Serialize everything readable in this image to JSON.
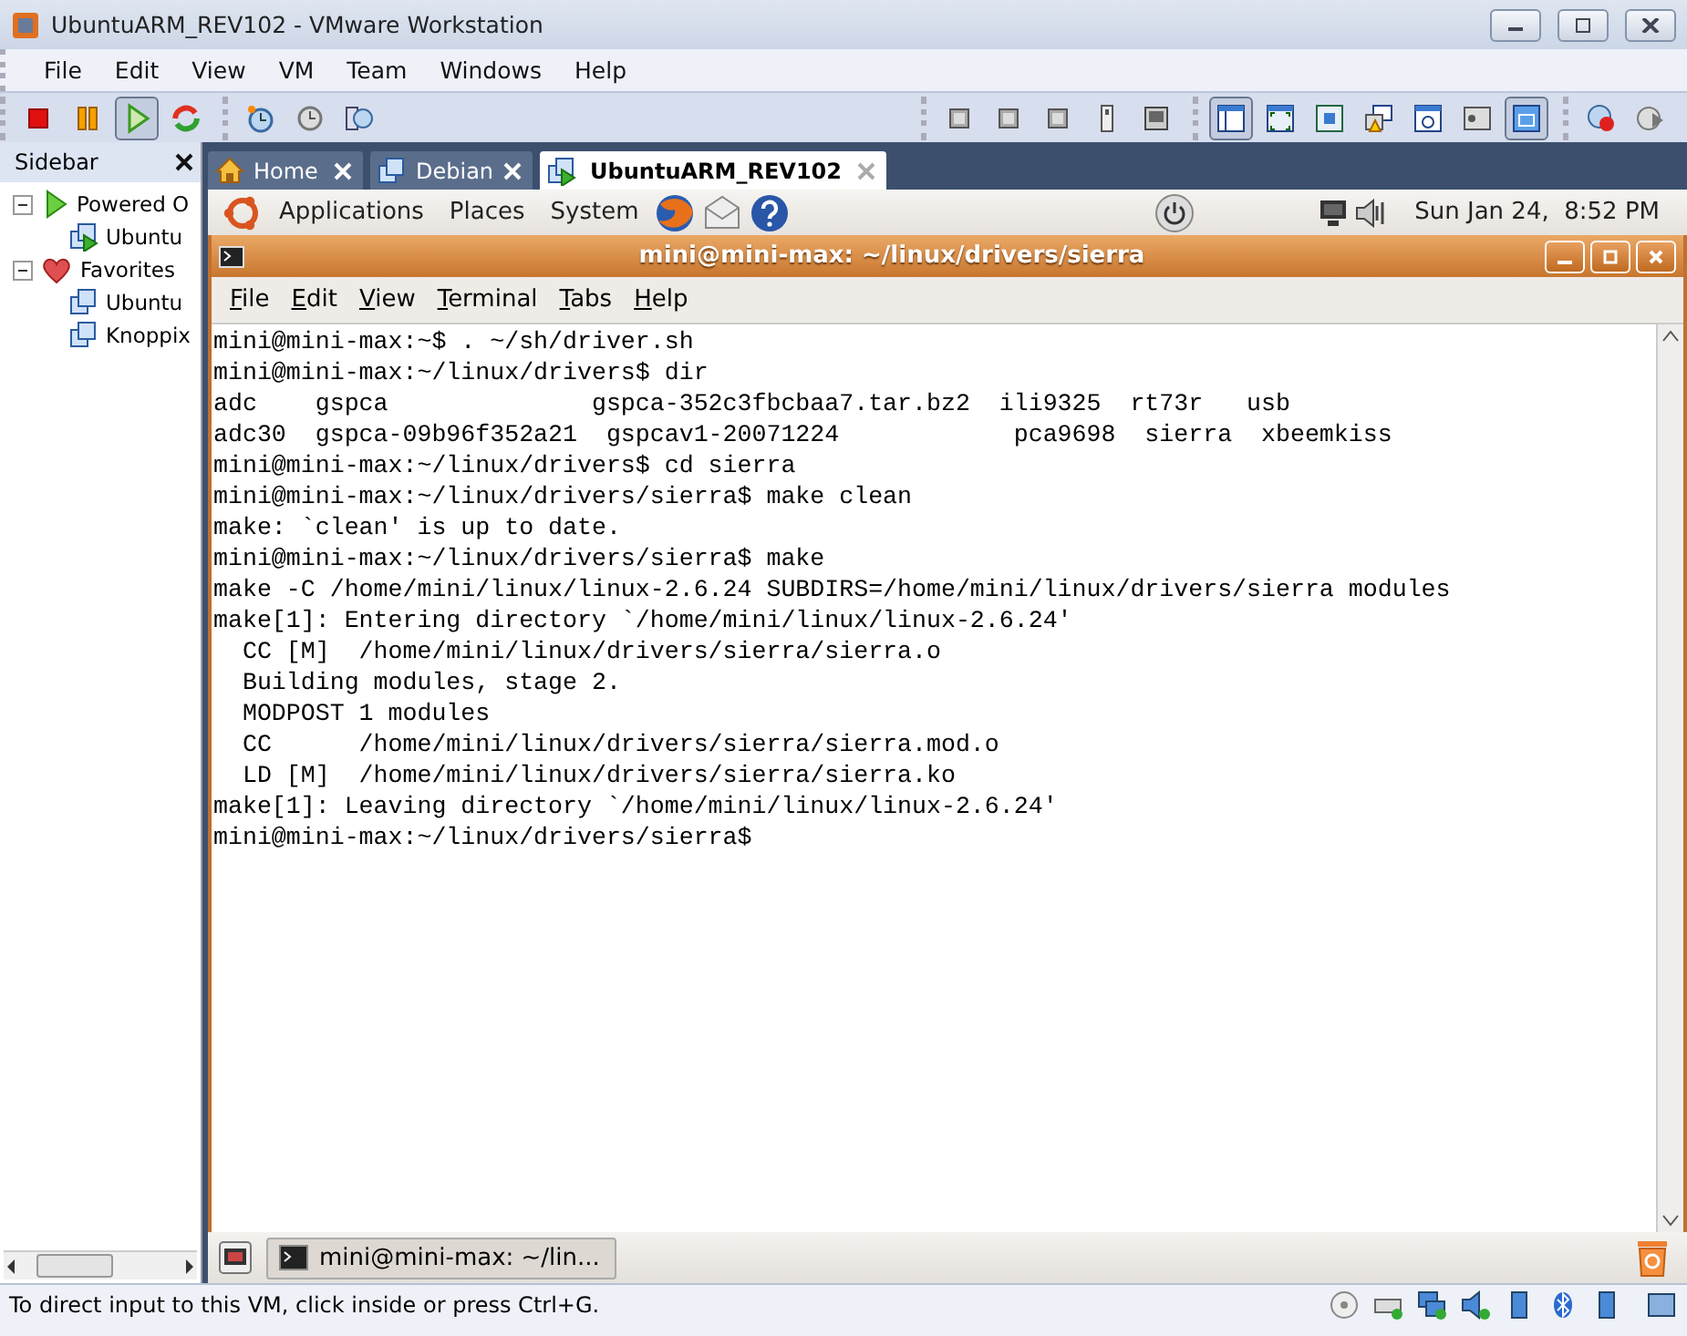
{
  "window": {
    "title": "UbuntuARM_REV102 - VMware Workstation"
  },
  "menu": [
    "File",
    "Edit",
    "View",
    "VM",
    "Team",
    "Windows",
    "Help"
  ],
  "toolbar": {
    "groups": [
      [
        {
          "kind": "stop",
          "pressed": false
        },
        {
          "kind": "pause",
          "pressed": false
        },
        {
          "kind": "play",
          "pressed": true
        },
        {
          "kind": "reset",
          "pressed": false
        }
      ],
      [
        {
          "kind": "snapshot",
          "pressed": false
        },
        {
          "kind": "revert",
          "pressed": false
        },
        {
          "kind": "manager",
          "pressed": false
        }
      ],
      [
        {
          "kind": "device",
          "pressed": false
        },
        {
          "kind": "device",
          "pressed": false
        },
        {
          "kind": "device",
          "pressed": false
        },
        {
          "kind": "usb",
          "pressed": false
        },
        {
          "kind": "console",
          "pressed": false
        }
      ],
      [
        {
          "kind": "sidebar",
          "pressed": true
        },
        {
          "kind": "fullscreen",
          "pressed": false
        },
        {
          "kind": "quickswitch",
          "pressed": false
        },
        {
          "kind": "unity",
          "pressed": false
        },
        {
          "kind": "settings",
          "pressed": false
        },
        {
          "kind": "summary",
          "pressed": false
        },
        {
          "kind": "console-view",
          "pressed": true
        }
      ],
      [
        {
          "kind": "record",
          "pressed": false
        },
        {
          "kind": "replay",
          "pressed": false
        }
      ]
    ]
  },
  "sidebar": {
    "title": "Sidebar",
    "items": [
      {
        "label": "Powered O",
        "kind": "powered",
        "expanded": true,
        "children": [
          {
            "label": "Ubuntu",
            "running": true
          }
        ]
      },
      {
        "label": "Favorites",
        "kind": "favorites",
        "expanded": true,
        "children": [
          {
            "label": "Ubuntu",
            "running": false
          },
          {
            "label": "Knoppix",
            "running": false
          }
        ]
      }
    ]
  },
  "tabs": [
    {
      "label": "Home",
      "kind": "home",
      "selected": false
    },
    {
      "label": "Debian",
      "kind": "vm",
      "selected": false
    },
    {
      "label": "UbuntuARM_REV102",
      "kind": "vm",
      "selected": true
    }
  ],
  "guest_panel": {
    "menus": [
      "Applications",
      "Places",
      "System"
    ],
    "clock": "Sun Jan 24,  8:52 PM"
  },
  "terminal": {
    "title": "mini@mini-max: ~/linux/drivers/sierra",
    "menu": [
      "File",
      "Edit",
      "View",
      "Terminal",
      "Tabs",
      "Help"
    ],
    "lines": [
      "mini@mini-max:~$ . ~/sh/driver.sh",
      "mini@mini-max:~/linux/drivers$ dir",
      "adc    gspca              gspca-352c3fbcbaa7.tar.bz2  ili9325  rt73r   usb",
      "adc30  gspca-09b96f352a21  gspcav1-20071224            pca9698  sierra  xbeemkiss",
      "mini@mini-max:~/linux/drivers$ cd sierra",
      "mini@mini-max:~/linux/drivers/sierra$ make clean",
      "make: `clean' is up to date.",
      "mini@mini-max:~/linux/drivers/sierra$ make",
      "make -C /home/mini/linux/linux-2.6.24 SUBDIRS=/home/mini/linux/drivers/sierra modules",
      "make[1]: Entering directory `/home/mini/linux/linux-2.6.24'",
      "  CC [M]  /home/mini/linux/drivers/sierra/sierra.o",
      "  Building modules, stage 2.",
      "  MODPOST 1 modules",
      "  CC      /home/mini/linux/drivers/sierra/sierra.mod.o",
      "  LD [M]  /home/mini/linux/drivers/sierra/sierra.ko",
      "make[1]: Leaving directory `/home/mini/linux/linux-2.6.24'",
      "mini@mini-max:~/linux/drivers/sierra$"
    ]
  },
  "guest_taskbar": {
    "task": "mini@mini-max: ~/lin..."
  },
  "status_bar": {
    "text": "To direct input to this VM, click inside or press Ctrl+G."
  }
}
